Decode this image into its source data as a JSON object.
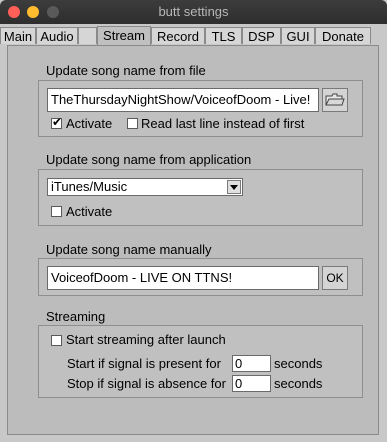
{
  "window": {
    "title": "butt settings"
  },
  "tabs": [
    {
      "label": "Main"
    },
    {
      "label": "Audio"
    },
    {
      "label": "Stream",
      "active": true
    },
    {
      "label": "Record"
    },
    {
      "label": "TLS"
    },
    {
      "label": "DSP"
    },
    {
      "label": "GUI"
    },
    {
      "label": "Donate"
    }
  ],
  "file_group": {
    "title": "Update song name from file",
    "path_value": "TheThursdayNightShow/VoiceofDoom - Live!",
    "activate_label": "Activate",
    "activate_checked": true,
    "last_line_label": "Read last line instead of first",
    "last_line_checked": false,
    "browse_icon": "folder-icon"
  },
  "app_group": {
    "title": "Update song name from application",
    "selected_app": "iTunes/Music",
    "activate_label": "Activate",
    "activate_checked": false
  },
  "manual_group": {
    "title": "Update song name manually",
    "song_value": "VoiceofDoom - LIVE ON TTNS!",
    "ok_label": "OK"
  },
  "streaming_group": {
    "title": "Streaming",
    "start_after_launch_label": "Start streaming after launch",
    "start_after_launch_checked": false,
    "signal_present_label": "Start if signal is present for",
    "signal_present_value": "0",
    "signal_present_unit": "seconds",
    "signal_absent_label": "Stop if signal is absence for",
    "signal_absent_value": "0",
    "signal_absent_unit": "seconds"
  }
}
